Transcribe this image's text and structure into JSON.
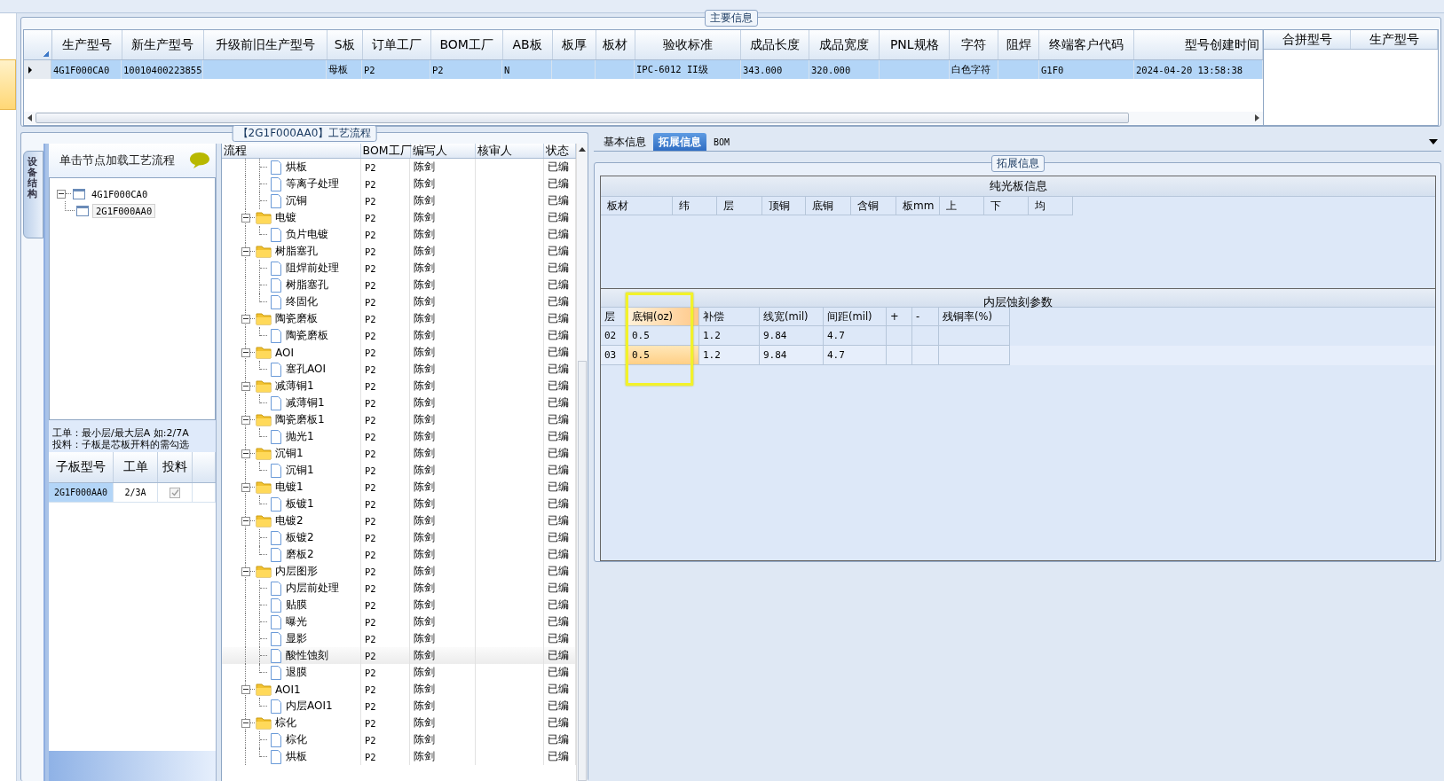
{
  "main_info": {
    "title": "主要信息",
    "columns": [
      "生产型号",
      "新生产型号",
      "升级前旧生产型号",
      "S板",
      "订单工厂",
      "BOM工厂",
      "AB板",
      "板厚",
      "板材",
      "验收标准",
      "成品长度",
      "成品宽度",
      "PNL规格",
      "字符",
      "阻焊",
      "终端客户代码",
      "型号创建时间"
    ],
    "rows": [
      {
        "selected": true,
        "cells": [
          "4G1F000CA0",
          "10010400223855",
          "",
          "母板",
          "P2",
          "P2",
          "N",
          "",
          "",
          "IPC-6012 II级",
          "343.000",
          "320.000",
          "",
          "白色字符",
          "",
          "G1F0",
          "2024-04-20 13:58:38"
        ]
      }
    ],
    "side_columns": [
      "合拼型号",
      "生产型号"
    ]
  },
  "left_panel": {
    "side_tab": "设备结构",
    "header": "单击节点加载工艺流程",
    "tree": [
      {
        "label": "4G1F000CA0",
        "selected": false,
        "children": [
          {
            "label": "2G1F000AA0",
            "selected": true
          }
        ]
      }
    ],
    "notes": [
      "工单：最小层/最大层A 如:2/7A",
      "投料：子板是芯板开料的需勾选"
    ],
    "sub_columns": [
      "子板型号",
      "工单",
      "投料"
    ],
    "sub_rows": [
      {
        "model": "2G1F000AA0",
        "order": "2/3A",
        "checked": true
      }
    ]
  },
  "flow": {
    "title": "【2G1F000AA0】工艺流程",
    "columns": [
      "流程",
      "BOM工厂",
      "编写人",
      "核审人",
      "状态"
    ],
    "nodes": [
      {
        "kind": "file",
        "name": "烘板",
        "factory": "P2",
        "writer": "陈剑",
        "status": "已编",
        "selected": false
      },
      {
        "kind": "file",
        "name": "等离子处理",
        "factory": "P2",
        "writer": "陈剑",
        "status": "已编",
        "selected": false
      },
      {
        "kind": "file",
        "name": "沉铜",
        "factory": "P2",
        "writer": "陈剑",
        "status": "已编",
        "selected": false
      },
      {
        "kind": "folder",
        "name": "电镀",
        "factory": "P2",
        "writer": "陈剑",
        "status": "已编",
        "selected": false,
        "children": [
          {
            "kind": "file",
            "name": "负片电镀",
            "factory": "P2",
            "writer": "陈剑",
            "status": "已编",
            "selected": false
          }
        ]
      },
      {
        "kind": "folder",
        "name": "树脂塞孔",
        "factory": "P2",
        "writer": "陈剑",
        "status": "已编",
        "selected": false,
        "children": [
          {
            "kind": "file",
            "name": "阻焊前处理",
            "factory": "P2",
            "writer": "陈剑",
            "status": "已编",
            "selected": false
          },
          {
            "kind": "file",
            "name": "树脂塞孔",
            "factory": "P2",
            "writer": "陈剑",
            "status": "已编",
            "selected": false
          },
          {
            "kind": "file",
            "name": "终固化",
            "factory": "P2",
            "writer": "陈剑",
            "status": "已编",
            "selected": false
          }
        ]
      },
      {
        "kind": "folder",
        "name": "陶瓷磨板",
        "factory": "P2",
        "writer": "陈剑",
        "status": "已编",
        "selected": false,
        "children": [
          {
            "kind": "file",
            "name": "陶瓷磨板",
            "factory": "P2",
            "writer": "陈剑",
            "status": "已编",
            "selected": false
          }
        ]
      },
      {
        "kind": "folder",
        "name": "AOI",
        "factory": "P2",
        "writer": "陈剑",
        "status": "已编",
        "selected": false,
        "children": [
          {
            "kind": "file",
            "name": "塞孔AOI",
            "factory": "P2",
            "writer": "陈剑",
            "status": "已编",
            "selected": false
          }
        ]
      },
      {
        "kind": "folder",
        "name": "减薄铜1",
        "factory": "P2",
        "writer": "陈剑",
        "status": "已编",
        "selected": false,
        "children": [
          {
            "kind": "file",
            "name": "减薄铜1",
            "factory": "P2",
            "writer": "陈剑",
            "status": "已编",
            "selected": false
          }
        ]
      },
      {
        "kind": "folder",
        "name": "陶瓷磨板1",
        "factory": "P2",
        "writer": "陈剑",
        "status": "已编",
        "selected": false,
        "children": [
          {
            "kind": "file",
            "name": "抛光1",
            "factory": "P2",
            "writer": "陈剑",
            "status": "已编",
            "selected": false
          }
        ]
      },
      {
        "kind": "folder",
        "name": "沉铜1",
        "factory": "P2",
        "writer": "陈剑",
        "status": "已编",
        "selected": false,
        "children": [
          {
            "kind": "file",
            "name": "沉铜1",
            "factory": "P2",
            "writer": "陈剑",
            "status": "已编",
            "selected": false
          }
        ]
      },
      {
        "kind": "folder",
        "name": "电镀1",
        "factory": "P2",
        "writer": "陈剑",
        "status": "已编",
        "selected": false,
        "children": [
          {
            "kind": "file",
            "name": "板镀1",
            "factory": "P2",
            "writer": "陈剑",
            "status": "已编",
            "selected": false
          }
        ]
      },
      {
        "kind": "folder",
        "name": "电镀2",
        "factory": "P2",
        "writer": "陈剑",
        "status": "已编",
        "selected": false,
        "children": [
          {
            "kind": "file",
            "name": "板镀2",
            "factory": "P2",
            "writer": "陈剑",
            "status": "已编",
            "selected": false
          },
          {
            "kind": "file",
            "name": "磨板2",
            "factory": "P2",
            "writer": "陈剑",
            "status": "已编",
            "selected": false
          }
        ]
      },
      {
        "kind": "folder",
        "name": "内层图形",
        "factory": "P2",
        "writer": "陈剑",
        "status": "已编",
        "selected": false,
        "children": [
          {
            "kind": "file",
            "name": "内层前处理",
            "factory": "P2",
            "writer": "陈剑",
            "status": "已编",
            "selected": false
          },
          {
            "kind": "file",
            "name": "贴膜",
            "factory": "P2",
            "writer": "陈剑",
            "status": "已编",
            "selected": false
          },
          {
            "kind": "file",
            "name": "曝光",
            "factory": "P2",
            "writer": "陈剑",
            "status": "已编",
            "selected": false
          },
          {
            "kind": "file",
            "name": "显影",
            "factory": "P2",
            "writer": "陈剑",
            "status": "已编",
            "selected": false
          },
          {
            "kind": "file",
            "name": "酸性蚀刻",
            "factory": "P2",
            "writer": "陈剑",
            "status": "已编",
            "selected": true
          },
          {
            "kind": "file",
            "name": "退膜",
            "factory": "P2",
            "writer": "陈剑",
            "status": "已编",
            "selected": false
          }
        ]
      },
      {
        "kind": "folder",
        "name": "AOI1",
        "factory": "P2",
        "writer": "陈剑",
        "status": "已编",
        "selected": false,
        "children": [
          {
            "kind": "file",
            "name": "内层AOI1",
            "factory": "P2",
            "writer": "陈剑",
            "status": "已编",
            "selected": false
          }
        ]
      },
      {
        "kind": "folder",
        "name": "棕化",
        "factory": "P2",
        "writer": "陈剑",
        "status": "已编",
        "selected": false,
        "children": [
          {
            "kind": "file",
            "name": "棕化",
            "factory": "P2",
            "writer": "陈剑",
            "status": "已编",
            "selected": false
          },
          {
            "kind": "file",
            "name": "烘板",
            "factory": "P2",
            "writer": "陈剑",
            "status": "已编",
            "selected": false
          }
        ]
      }
    ]
  },
  "detail": {
    "tabs": [
      {
        "label": "基本信息",
        "selected": false
      },
      {
        "label": "拓展信息",
        "selected": true
      },
      {
        "label": "BOM",
        "selected": false
      }
    ],
    "group_title": "拓展信息",
    "plain_board": {
      "title": "纯光板信息",
      "columns": [
        "板材",
        "纬",
        "层",
        "顶铜",
        "底铜",
        "含铜",
        "板mm",
        "上",
        "下",
        "均"
      ]
    },
    "etch": {
      "title": "内层蚀刻参数",
      "columns": [
        {
          "label": "层",
          "focused": false
        },
        {
          "label": "底铜(oz)",
          "focused": true
        },
        {
          "label": "补偿",
          "focused": false
        },
        {
          "label": "线宽(mil)",
          "focused": false
        },
        {
          "label": "间距(mil)",
          "focused": false
        },
        {
          "label": "+",
          "focused": false
        },
        {
          "label": "-",
          "focused": false
        },
        {
          "label": "残铜率(%)",
          "focused": false
        }
      ],
      "rows": [
        {
          "selected": false,
          "cells": [
            "02",
            "0.5",
            "1.2",
            "9.84",
            "4.7",
            "",
            "",
            ""
          ]
        },
        {
          "selected": true,
          "cells": [
            "03",
            "0.5",
            "1.2",
            "9.84",
            "4.7",
            "",
            "",
            ""
          ]
        }
      ]
    }
  }
}
